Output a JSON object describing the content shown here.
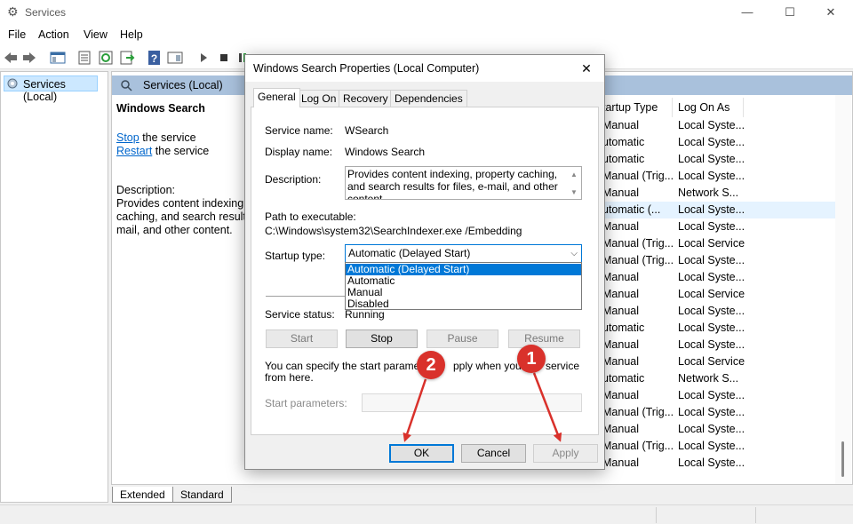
{
  "window": {
    "title": "Services",
    "menu": [
      "File",
      "Action",
      "View",
      "Help"
    ]
  },
  "tree": {
    "root_label": "Services (Local)"
  },
  "content": {
    "header": "Services (Local)",
    "selected_service": "Windows Search",
    "stop_link": "Stop",
    "stop_suffix": " the service",
    "restart_link": "Restart",
    "restart_suffix": " the service",
    "description_label": "Description:",
    "description_lines": [
      "Provides content indexing,",
      "caching, and search results",
      "mail, and other content."
    ],
    "columns": {
      "startup_type": "tartup Type",
      "log_on_as": "Log On As"
    },
    "rows": [
      {
        "startup": "Manual",
        "logon": "Local Syste..."
      },
      {
        "startup": "utomatic",
        "logon": "Local Syste..."
      },
      {
        "startup": "utomatic",
        "logon": "Local Syste..."
      },
      {
        "startup": "Manual (Trig...",
        "logon": "Local Syste..."
      },
      {
        "startup": "Manual",
        "logon": "Network S..."
      },
      {
        "startup": "utomatic (...",
        "logon": "Local Syste..."
      },
      {
        "startup": "Manual",
        "logon": "Local Syste..."
      },
      {
        "startup": "Manual (Trig...",
        "logon": "Local Service"
      },
      {
        "startup": "Manual (Trig...",
        "logon": "Local Syste..."
      },
      {
        "startup": "Manual",
        "logon": "Local Syste..."
      },
      {
        "startup": "Manual",
        "logon": "Local Service"
      },
      {
        "startup": "Manual",
        "logon": "Local Syste..."
      },
      {
        "startup": "utomatic",
        "logon": "Local Syste..."
      },
      {
        "startup": "Manual",
        "logon": "Local Syste..."
      },
      {
        "startup": "Manual",
        "logon": "Local Service"
      },
      {
        "startup": "utomatic",
        "logon": "Network S..."
      },
      {
        "startup": "Manual",
        "logon": "Local Syste..."
      },
      {
        "startup": "Manual (Trig...",
        "logon": "Local Syste..."
      },
      {
        "startup": "Manual",
        "logon": "Local Syste..."
      },
      {
        "startup": "Manual (Trig...",
        "logon": "Local Syste..."
      },
      {
        "startup": "Manual",
        "logon": "Local Syste..."
      }
    ],
    "bottom_tabs": [
      "Extended",
      "Standard"
    ]
  },
  "dialog": {
    "title": "Windows Search Properties (Local Computer)",
    "tabs": [
      "General",
      "Log On",
      "Recovery",
      "Dependencies"
    ],
    "service_name_label": "Service name:",
    "service_name": "WSearch",
    "display_name_label": "Display name:",
    "display_name": "Windows Search",
    "description_label": "Description:",
    "description": "Provides content indexing, property caching, and search results for files, e-mail, and other content.",
    "path_label": "Path to executable:",
    "path": "C:\\Windows\\system32\\SearchIndexer.exe /Embedding",
    "startup_type_label": "Startup type:",
    "startup_type_value": "Automatic (Delayed Start)",
    "startup_options": [
      "Automatic (Delayed Start)",
      "Automatic",
      "Manual",
      "Disabled"
    ],
    "service_status_label": "Service status:",
    "service_status": "Running",
    "buttons": {
      "start": "Start",
      "stop": "Stop",
      "pause": "Pause",
      "resume": "Resume"
    },
    "params_text_1": "You can specify the start parameters",
    "params_text_1b": "pply when you sta",
    "params_text_1c": "service",
    "params_text_2": "from here.",
    "start_params_label": "Start parameters:",
    "ok": "OK",
    "cancel": "Cancel",
    "apply": "Apply"
  },
  "annotations": {
    "badge_1": "1",
    "badge_2": "2",
    "color": "#d9312b"
  }
}
